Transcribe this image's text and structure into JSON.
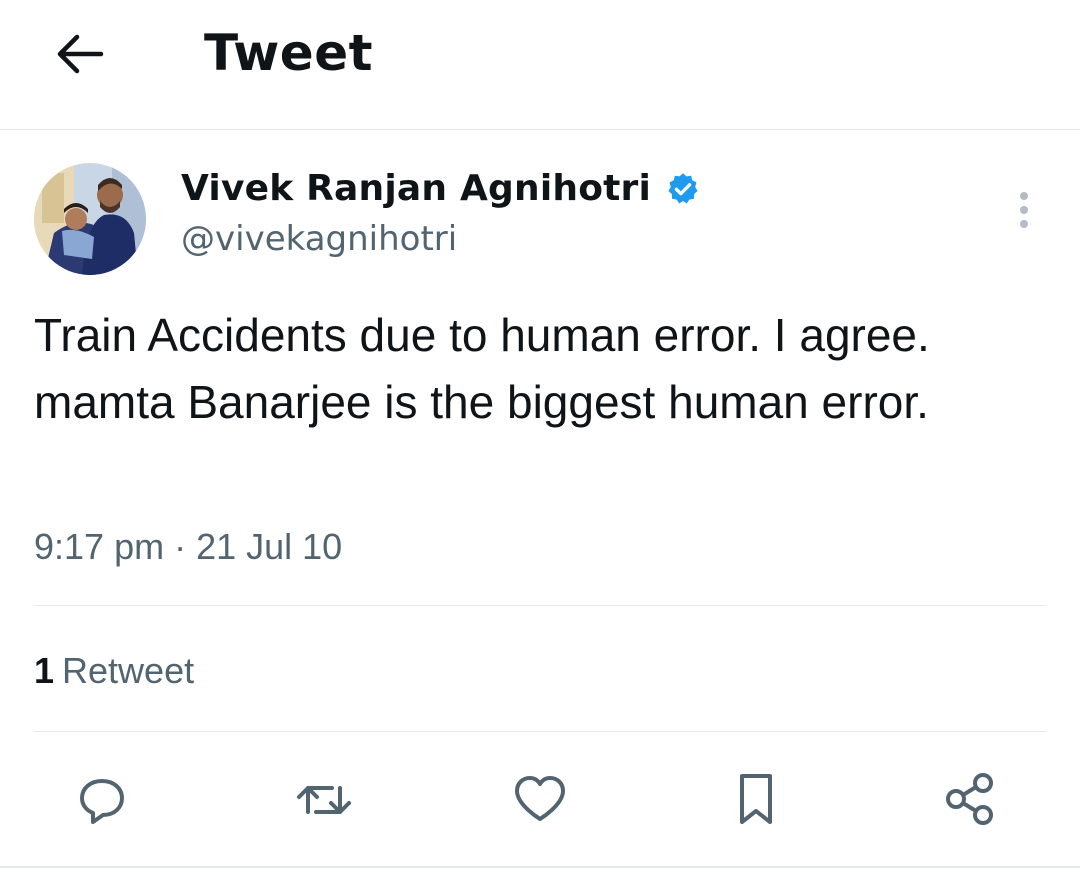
{
  "header": {
    "title": "Tweet",
    "back_icon": "arrow-left-icon"
  },
  "author": {
    "name": "Vivek Ranjan Agnihotri",
    "handle": "@vivekagnihotri",
    "verified": true,
    "verified_color": "#1d9bf0"
  },
  "tweet": {
    "text": "Train Accidents due to human error. I agree. mamta Banarjee is the biggest human error.",
    "timestamp": "9:17 pm · 21 Jul 10"
  },
  "stats": {
    "retweet_count": "1",
    "retweet_label": "Retweet"
  },
  "actions": [
    "reply-icon",
    "retweet-icon",
    "like-icon",
    "bookmark-icon",
    "share-icon"
  ],
  "colors": {
    "text": "#0f1419",
    "secondary": "#536471",
    "divider": "#e6e9ec"
  }
}
